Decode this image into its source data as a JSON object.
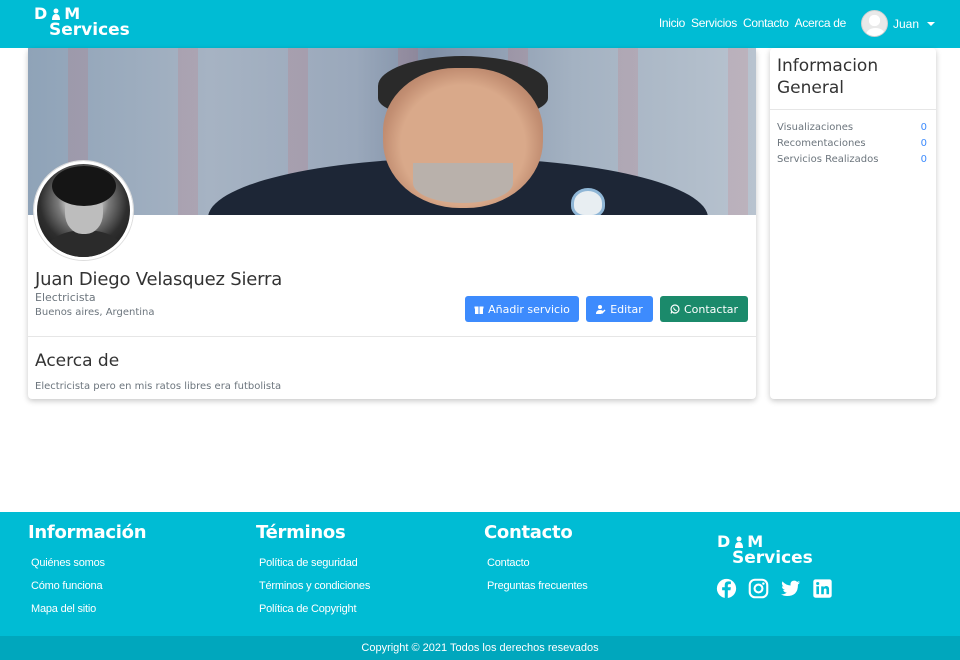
{
  "brand": {
    "line1_left": "D",
    "line1_right": "M",
    "line2": "Services"
  },
  "nav": {
    "items": [
      "Inicio",
      "Servicios",
      "Contacto",
      "Acerca de"
    ],
    "user_name": "Juan"
  },
  "profile": {
    "name": "Juan Diego Velasquez Sierra",
    "title": "Electricista",
    "location": "Buenos aires, Argentina",
    "buttons": {
      "add": "Añadir servicio",
      "edit": "Editar",
      "contact": "Contactar"
    },
    "about_heading": "Acerca de",
    "about_text": "Electricista pero en mis ratos libres era futbolista"
  },
  "info": {
    "heading": "Informacion General",
    "stats": [
      {
        "label": "Visualizaciones",
        "value": "0"
      },
      {
        "label": "Recomentaciones",
        "value": "0"
      },
      {
        "label": "Servicios Realizados",
        "value": "0"
      }
    ]
  },
  "footer": {
    "info": {
      "title": "Información",
      "links": [
        "Quiénes somos",
        "Cómo funciona",
        "Mapa del sitio"
      ]
    },
    "terms": {
      "title": "Términos",
      "links": [
        "Política de seguridad",
        "Términos y condiciones",
        "Política de Copyright"
      ]
    },
    "contact": {
      "title": "Contacto",
      "links": [
        "Contacto",
        "Preguntas frecuentes"
      ]
    },
    "socials": [
      "facebook-icon",
      "instagram-icon",
      "twitter-icon",
      "linkedin-icon"
    ],
    "copyright": "Copyright © 2021 Todos los derechos resevados"
  },
  "colors": {
    "primary": "#00bcd4",
    "button_blue": "#3d8bfd",
    "button_green": "#1b8a6b"
  }
}
